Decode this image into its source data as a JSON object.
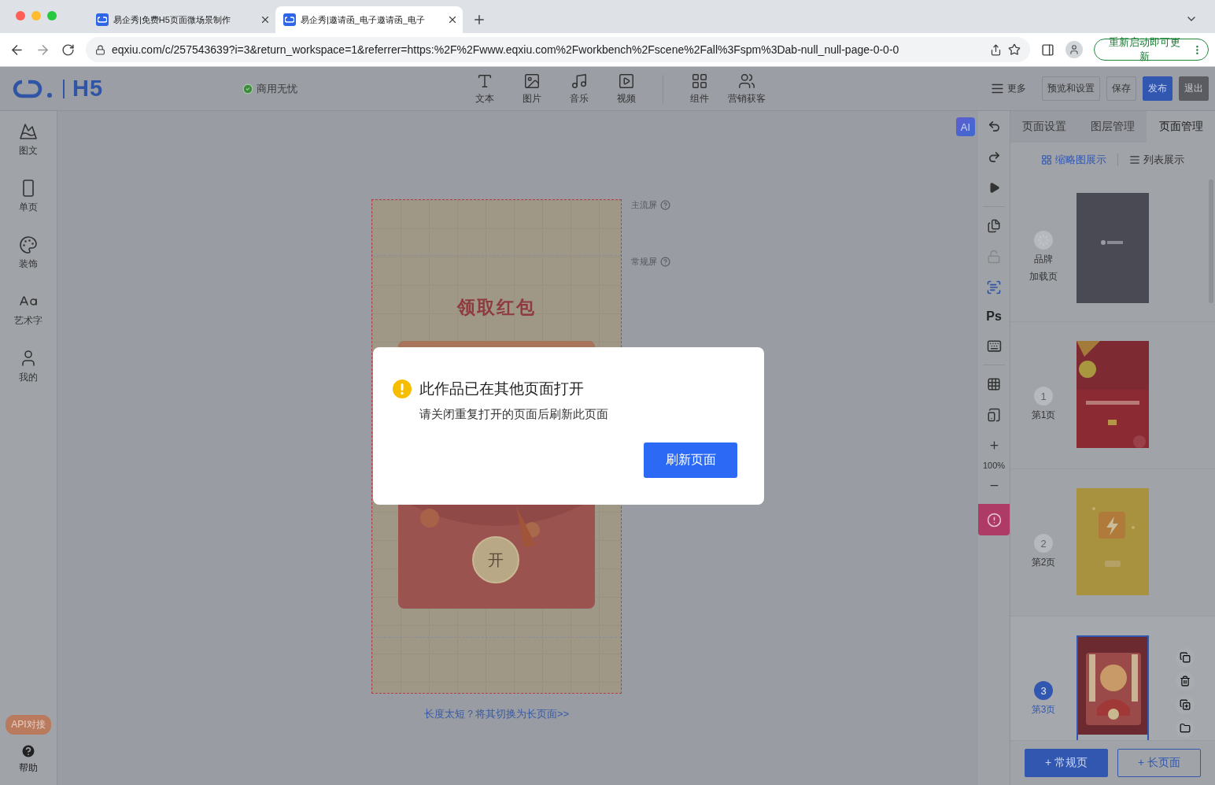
{
  "browser": {
    "tabs": [
      {
        "title": "易企秀|免费H5页面微场景制作",
        "selected": false
      },
      {
        "title": "易企秀|邀请函_电子邀请函_电子",
        "selected": true
      }
    ],
    "url": "eqxiu.com/c/257543639?i=3&return_workspace=1&referrer=https:%2F%2Fwww.eqxiu.com%2Fworkbench%2Fscene%2Fall%3Fspm%3Dab-null_null-page-0-0-0",
    "update_button": "重新启动即可更新"
  },
  "header": {
    "logo": "H5",
    "status": "商用无忧",
    "tools": [
      "文本",
      "图片",
      "音乐",
      "视频",
      "组件",
      "营销获客"
    ],
    "more": "更多",
    "actions": [
      {
        "label": "预览和设置",
        "kind": "outline"
      },
      {
        "label": "保存",
        "kind": "outline"
      },
      {
        "label": "发布",
        "kind": "primary"
      },
      {
        "label": "退出",
        "kind": "dark"
      }
    ]
  },
  "sidebar": {
    "items": [
      "图文",
      "单页",
      "装饰",
      "艺术字",
      "我的"
    ],
    "api_badge": "API对接",
    "help": "帮助"
  },
  "canvas": {
    "ai_badge": "AI",
    "screen_labels": [
      "主流屏",
      "常规屏"
    ],
    "title": "领取红包",
    "open_button": "开",
    "switch_link": "长度太短？将其切换为长页面>>"
  },
  "toolbar": {
    "ps": "Ps",
    "zoom": "100%"
  },
  "panel": {
    "tabs": [
      {
        "label": "页面设置",
        "selected": false
      },
      {
        "label": "图层管理",
        "selected": false
      },
      {
        "label": "页面管理",
        "selected": true
      }
    ],
    "views": [
      {
        "label": "缩略图展示",
        "selected": true
      },
      {
        "label": "列表展示",
        "selected": false
      }
    ],
    "pages": [
      {
        "kind": "brand",
        "lines": [
          "品牌",
          "加载页"
        ],
        "selected": false
      },
      {
        "kind": "page",
        "number": "1",
        "label": "第1页",
        "selected": false
      },
      {
        "kind": "page",
        "number": "2",
        "label": "第2页",
        "selected": false
      },
      {
        "kind": "page",
        "number": "3",
        "label": "第3页",
        "selected": true
      }
    ],
    "add_buttons": [
      {
        "label": "+ 常规页",
        "kind": "primary"
      },
      {
        "label": "+ 长页面",
        "kind": "outline"
      }
    ]
  },
  "dialog": {
    "title": "此作品已在其他页面打开",
    "message": "请关闭重复打开的页面后刷新此页面",
    "button": "刷新页面"
  }
}
